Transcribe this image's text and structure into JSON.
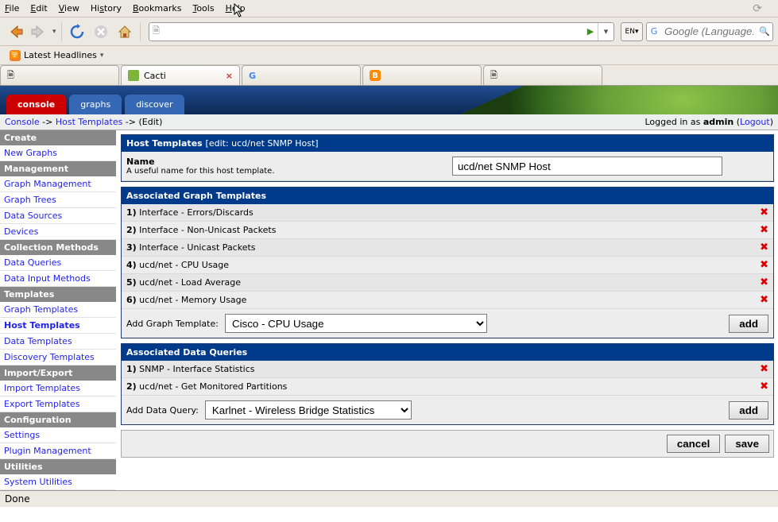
{
  "menubar": [
    "File",
    "Edit",
    "View",
    "History",
    "Bookmarks",
    "Tools",
    "Help"
  ],
  "bookmarks_bar": "Latest Headlines",
  "tabs": [
    {
      "label": "",
      "active": false
    },
    {
      "label": "Cacti",
      "active": true
    },
    {
      "label": "",
      "active": false
    },
    {
      "label": "",
      "active": false
    },
    {
      "label": "",
      "active": false
    }
  ],
  "search_placeholder": "Google (Language: E",
  "app_tabs": [
    "console",
    "graphs",
    "discover"
  ],
  "breadcrumb": {
    "c": "Console",
    "ht": "Host Templates",
    "edit": "(Edit)"
  },
  "login": {
    "pre": "Logged in as ",
    "user": "admin",
    "lo": "Logout"
  },
  "sidebar": [
    {
      "type": "head",
      "label": "Create"
    },
    {
      "type": "item",
      "label": "New Graphs"
    },
    {
      "type": "head",
      "label": "Management"
    },
    {
      "type": "item",
      "label": "Graph Management"
    },
    {
      "type": "item",
      "label": "Graph Trees"
    },
    {
      "type": "item",
      "label": "Data Sources"
    },
    {
      "type": "item",
      "label": "Devices"
    },
    {
      "type": "head",
      "label": "Collection Methods"
    },
    {
      "type": "item",
      "label": "Data Queries"
    },
    {
      "type": "item",
      "label": "Data Input Methods"
    },
    {
      "type": "head",
      "label": "Templates"
    },
    {
      "type": "item",
      "label": "Graph Templates"
    },
    {
      "type": "item",
      "label": "Host Templates",
      "active": true
    },
    {
      "type": "item",
      "label": "Data Templates"
    },
    {
      "type": "item",
      "label": "Discovery Templates"
    },
    {
      "type": "head",
      "label": "Import/Export"
    },
    {
      "type": "item",
      "label": "Import Templates"
    },
    {
      "type": "item",
      "label": "Export Templates"
    },
    {
      "type": "head",
      "label": "Configuration"
    },
    {
      "type": "item",
      "label": "Settings"
    },
    {
      "type": "item",
      "label": "Plugin Management"
    },
    {
      "type": "head",
      "label": "Utilities"
    },
    {
      "type": "item",
      "label": "System Utilities"
    }
  ],
  "ht_panel": {
    "title": "Host Templates",
    "sub": "[edit: ucd/net SNMP Host]"
  },
  "name_field": {
    "label": "Name",
    "desc": "A useful name for this host template.",
    "value": "ucd/net SNMP Host"
  },
  "gt_panel": "Associated Graph Templates",
  "graph_templates": [
    "Interface - Errors/Discards",
    "Interface - Non-Unicast Packets",
    "Interface - Unicast Packets",
    "ucd/net - CPU Usage",
    "ucd/net - Load Average",
    "ucd/net - Memory Usage"
  ],
  "add_gt": {
    "label": "Add Graph Template:",
    "selected": "Cisco - CPU Usage",
    "btn": "add"
  },
  "dq_panel": "Associated Data Queries",
  "data_queries": [
    "SNMP - Interface Statistics",
    "ucd/net - Get Monitored Partitions"
  ],
  "add_dq": {
    "label": "Add Data Query:",
    "selected": "Karlnet - Wireless Bridge Statistics",
    "btn": "add"
  },
  "actions": {
    "cancel": "cancel",
    "save": "save"
  },
  "status": "Done"
}
